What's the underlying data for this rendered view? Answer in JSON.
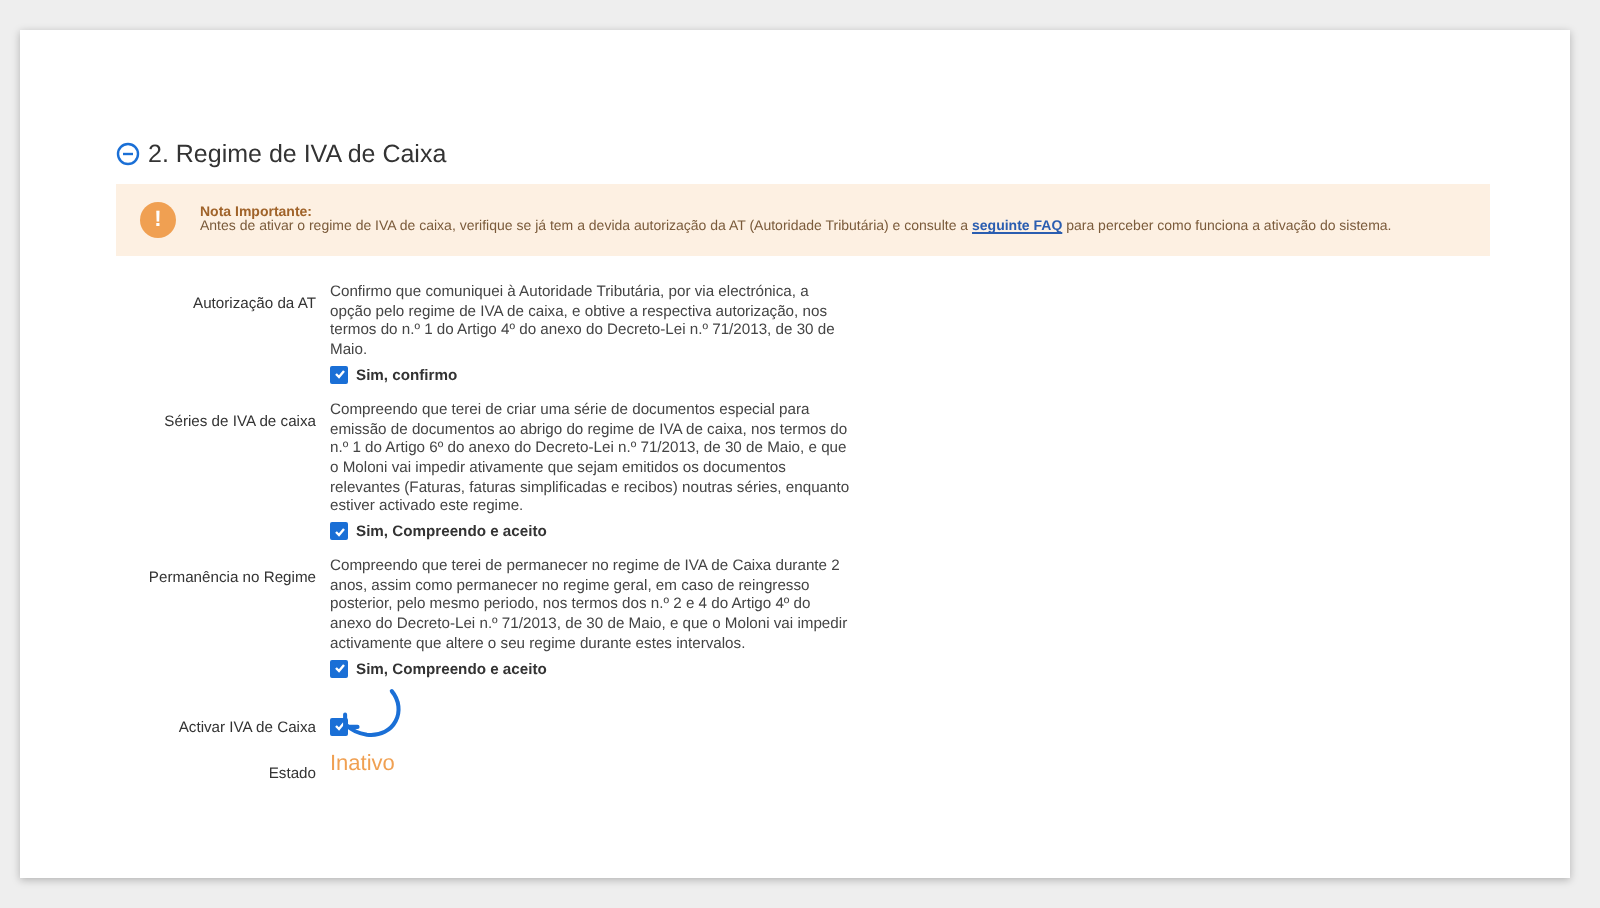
{
  "section": {
    "title": "2. Regime de IVA de Caixa",
    "expanded": true
  },
  "notice": {
    "icon": "!",
    "heading": "Nota Importante:",
    "text_before": "Antes de ativar o regime de IVA de caixa, verifique se já tem a devida autorização da AT (Autoridade Tributária) e consulte a",
    "link": "seguinte FAQ",
    "text_after": "para perceber como funciona a ativação do sistema."
  },
  "rows": [
    {
      "kind": "consent",
      "label": "Autorização da AT",
      "text": "Confirmo que comuniquei à Autoridade Tributária, por via electrónica, a opção pelo regime de IVA de caixa, e obtive a respectiva autorização, nos termos do n.º 1 do Artigo 4º do anexo do Decreto-Lei n.º 71/2013, de 30 de Maio.",
      "checkbox_label": "Sim, confirmo",
      "checked": true
    },
    {
      "kind": "consent",
      "label": "Séries de IVA de caixa",
      "text": "Compreendo que terei de criar uma série de documentos especial para emissão de documentos ao abrigo do regime de IVA de caixa, nos termos do n.º 1 do Artigo 6º do anexo do Decreto-Lei n.º 71/2013, de 30 de Maio, e que o Moloni vai impedir ativamente que sejam emitidos os documentos relevantes (Faturas, faturas simplificadas e recibos) noutras séries, enquanto estiver activado este regime.",
      "checkbox_label": "Sim, Compreendo e aceito",
      "checked": true
    },
    {
      "kind": "consent",
      "label": "Permanência no Regime",
      "text": "Compreendo que terei de permanecer no regime de IVA de Caixa durante 2 anos, assim como permanecer no regime geral, em caso de reingresso posterior, pelo mesmo periodo, nos termos dos n.º 2 e 4 do Artigo 4º do anexo do Decreto-Lei n.º 71/2013, de 30 de Maio, e que o Moloni vai impedir activamente que altere o seu regime durante estes intervalos.",
      "checkbox_label": "Sim, Compreendo e aceito",
      "checked": true
    },
    {
      "kind": "toggle",
      "label": "Activar IVA de Caixa",
      "checked": true
    },
    {
      "kind": "status",
      "label": "Estado",
      "value": "Inativo"
    }
  ]
}
